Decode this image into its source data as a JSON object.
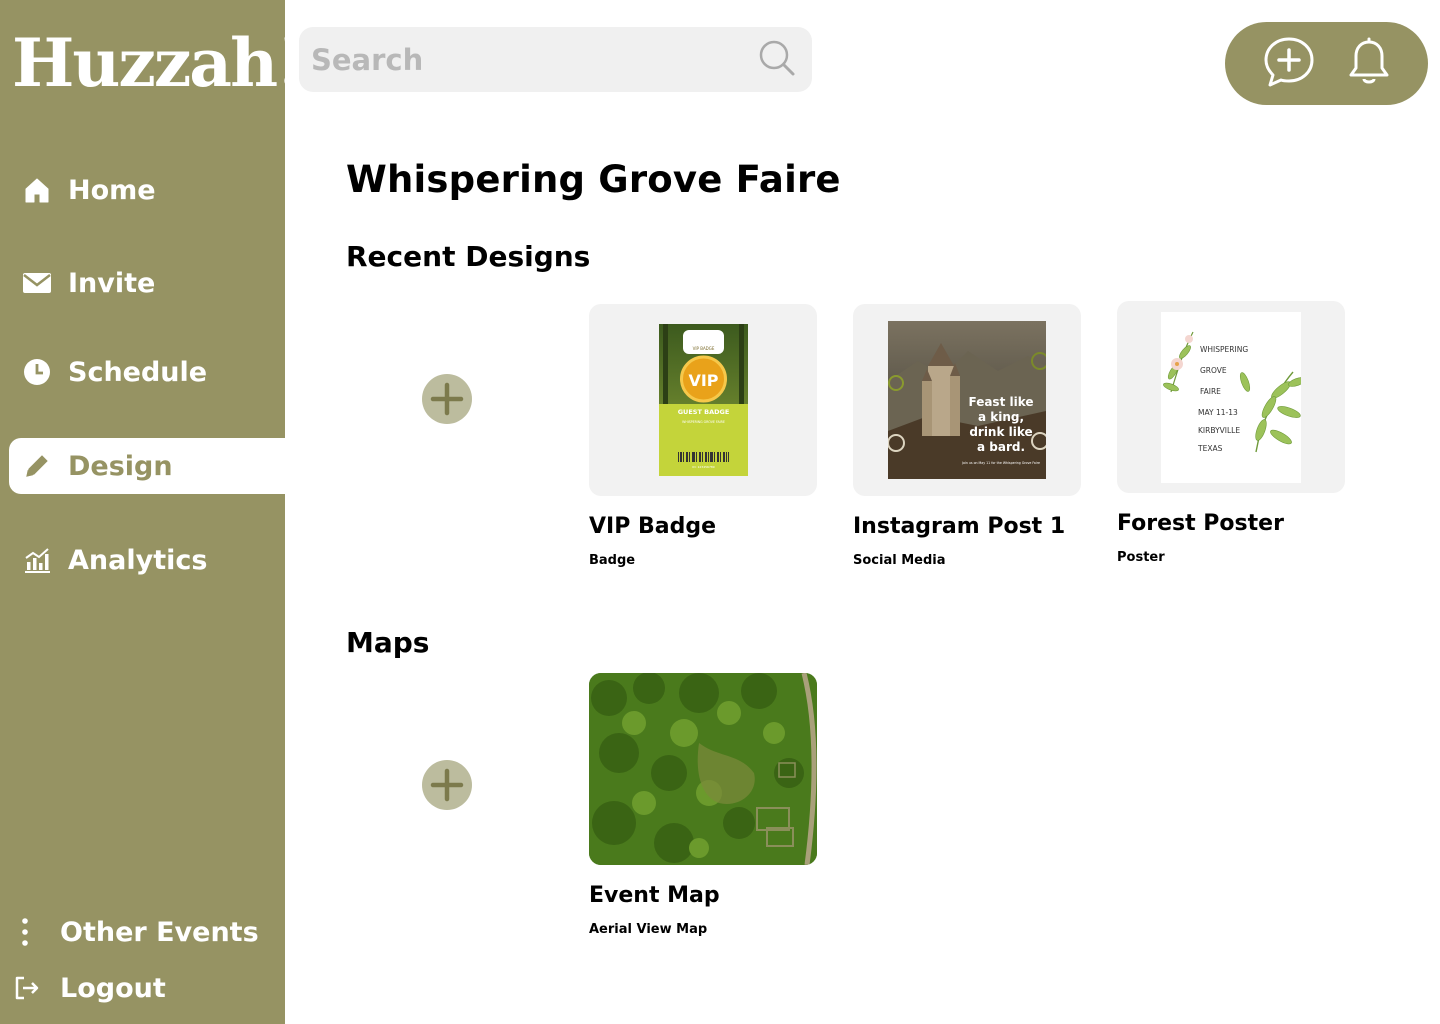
{
  "brand": {
    "logo_text": "Huzzah!"
  },
  "sidebar": {
    "items": [
      {
        "label": "Home",
        "icon": "home-icon"
      },
      {
        "label": "Invite",
        "icon": "envelope-icon"
      },
      {
        "label": "Schedule",
        "icon": "clock-icon"
      },
      {
        "label": "Design",
        "icon": "pencil-icon",
        "active": true
      },
      {
        "label": "Analytics",
        "icon": "chart-icon"
      }
    ],
    "footer": [
      {
        "label": "Other Events",
        "icon": "more-vertical-icon"
      },
      {
        "label": "Logout",
        "icon": "logout-icon"
      }
    ]
  },
  "search": {
    "placeholder": "Search"
  },
  "page": {
    "title": "Whispering Grove Faire"
  },
  "recent": {
    "title": "Recent Designs",
    "cards": [
      {
        "name": "VIP Badge",
        "type": "Badge",
        "thumb": {
          "top_label": "VIP BADGE",
          "medal": "VIP",
          "guest": "GUEST BADGE",
          "event": "WHISPERING GROVE FAIRE",
          "id": "ID: 123456789"
        }
      },
      {
        "name": "Instagram Post 1",
        "type": "Social Media",
        "thumb": {
          "line1": "Feast like",
          "line2": "a king,",
          "line3": "drink like",
          "line4": "a bard.",
          "small": "Join us on May 11 for the Whispering Grove Faire"
        }
      },
      {
        "name": "Forest Poster",
        "type": "Poster",
        "thumb": {
          "lines": [
            "WHISPERING",
            "GROVE",
            "FAIRE",
            "MAY 11-13",
            "KIRBYVILLE",
            "TEXAS"
          ]
        }
      }
    ]
  },
  "maps": {
    "title": "Maps",
    "cards": [
      {
        "name": "Event Map",
        "type": "Aerial View Map"
      }
    ]
  },
  "colors": {
    "olive": "#969363",
    "olive_light": "#bcbc9e",
    "card_bg": "#f2f2f2"
  }
}
